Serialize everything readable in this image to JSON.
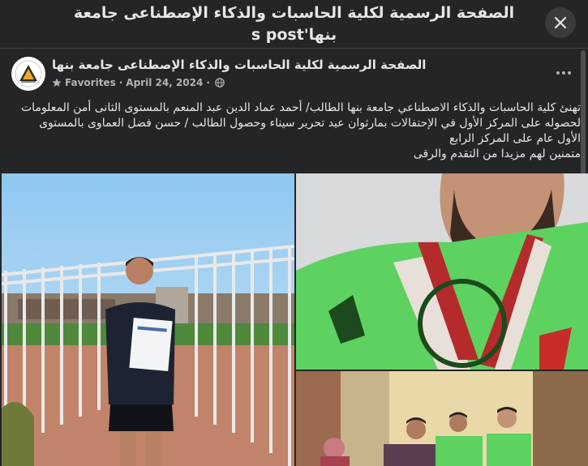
{
  "dialog": {
    "title": "الصفحة الرسمية لكلية الحاسبات والذكاء الإصطناعى جامعة بنها's post",
    "close_icon": "close-icon"
  },
  "post": {
    "page_name": "الصفحة الرسمية لكلية الحاسبات والذكاء الإصطناعى جامعة بنها",
    "audience_label": "Favorites",
    "separator": "·",
    "date": "April 24, 2024",
    "text_lines": [
      "تهنئ كلية الحاسبات والذكاء الاصطناعي جامعة بنها الطالب/ أحمد عماد الدين عبد المنعم بالمستوى الثانى أمن المعلومات لحصوله على المركز الأول في الإحتفالات بمارثوان عيد تحرير سيناء وحصول الطالب / حسن فضل العماوى بالمستوى الأول عام على المركز الرابع",
      "متمنين لهم مزيدا من التقدم والرقى"
    ]
  },
  "photos": [
    {
      "name": "photo-student-with-certificate"
    },
    {
      "name": "photo-student-with-medal"
    },
    {
      "name": "photo-group"
    }
  ],
  "colors": {
    "background": "#242526",
    "text": "#e4e6eb",
    "secondary_text": "#b0b3b8",
    "button": "#3a3b3c"
  }
}
